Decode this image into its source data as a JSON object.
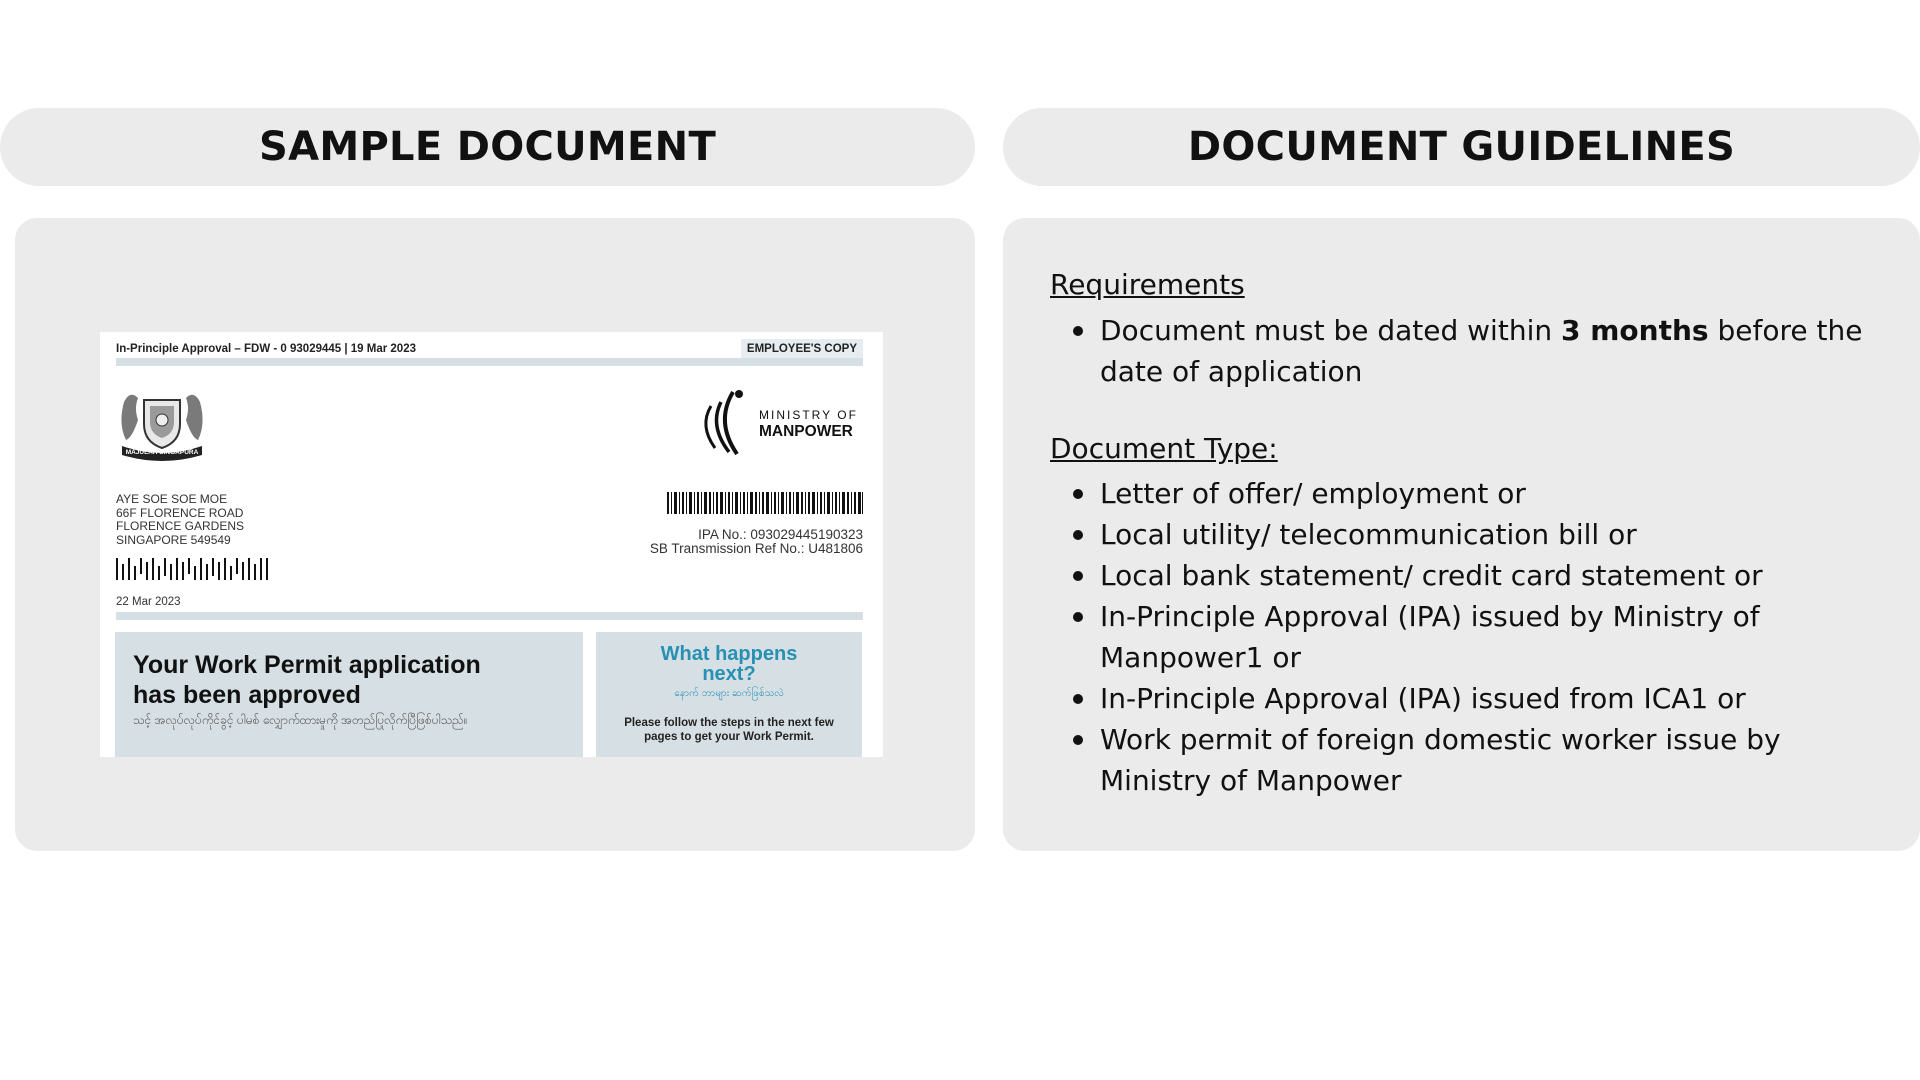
{
  "headers": {
    "left": "SAMPLE DOCUMENT",
    "right": "DOCUMENT GUIDELINES"
  },
  "sample": {
    "top_ref": "In-Principle Approval – FDW - 0 93029445 | 19 Mar 2023",
    "copy_tag": "EMPLOYEE'S COPY",
    "crest_motto": "MAJULAH SINGAPURA",
    "logo_line1": "MINISTRY OF",
    "logo_line2": "MANPOWER",
    "address": [
      "AYE SOE SOE MOE",
      "66F FLORENCE ROAD",
      "FLORENCE GARDENS",
      "SINGAPORE 549549"
    ],
    "ipa_no": "IPA No.: 093029445190323",
    "sb_ref": "SB Transmission Ref No.: U481806",
    "letter_date": "22 Mar 2023",
    "heading_line1": "Your Work Permit application",
    "heading_line2": "has been approved",
    "heading_myanmar": "သင့် အလုပ်လုပ်ကိုင်ခွင့် ပါမစ် လျှောက်ထားမှုကို အတည်ပြုလိုက်ပြီဖြစ်ပါသည်။",
    "next_line1": "What happens",
    "next_line2": "next?",
    "next_myanmar": "နောက် ဘာများ ဆက်ဖြစ်သလဲ",
    "steps_line1": "Please follow the steps in the next few",
    "steps_line2": "pages to get your Work Permit."
  },
  "guidelines": {
    "requirements_title": "Requirements",
    "requirements": {
      "pre": "Document must be dated within ",
      "bold": "3 months",
      "post": " before the date of application"
    },
    "type_title": "Document Type:",
    "types": [
      "Letter of offer/ employment or",
      "Local utility/ telecommunication bill or",
      "Local bank statement/ credit card statement or",
      "In-Principle Approval (IPA) issued by Ministry of Manpower1 or",
      "In-Principle Approval (IPA) issued from ICA1 or",
      "Work permit of foreign domestic worker issue by Ministry of Manpower"
    ]
  }
}
